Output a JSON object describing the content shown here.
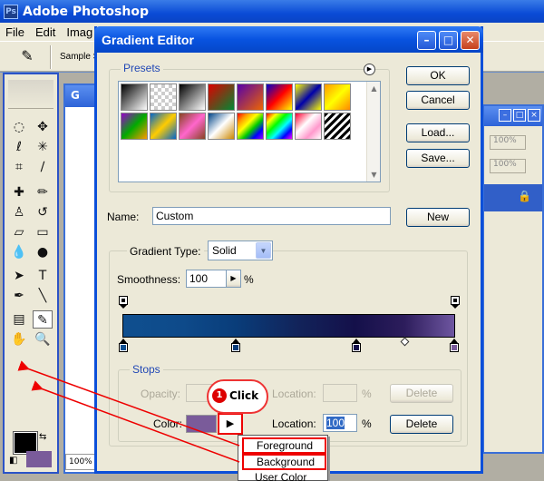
{
  "app": {
    "title": "Adobe Photoshop"
  },
  "menubar": [
    "File",
    "Edit",
    "Imag"
  ],
  "options_bar": {
    "sample_label": "Sample S"
  },
  "doc_window": {
    "title": "G",
    "zoom": "100%"
  },
  "right_panel": {
    "zoom_1": "100%",
    "zoom_2": "100%"
  },
  "dialog": {
    "title": "Gradient Editor",
    "presets_label": "Presets",
    "name_label": "Name:",
    "name_value": "Custom",
    "gradient_type_label": "Gradient Type:",
    "gradient_type_value": "Solid",
    "smoothness_label": "Smoothness:",
    "smoothness_value": "100",
    "smoothness_unit": "%",
    "stops_label": "Stops",
    "opacity_label": "Opacity:",
    "opacity_location_label": "Location:",
    "opacity_location_unit": "%",
    "color_label": "Color:",
    "color_location_label": "Location:",
    "color_location_value": "100",
    "color_location_unit": "%",
    "buttons": {
      "ok": "OK",
      "cancel": "Cancel",
      "load": "Load...",
      "save": "Save...",
      "new": "New",
      "delete_opacity": "Delete",
      "delete_color": "Delete"
    },
    "stop_color": "#7a5b9a"
  },
  "callout": {
    "number": "1",
    "text": "Click"
  },
  "popup_menu": {
    "items": [
      "Foreground",
      "Background",
      "User Color"
    ]
  }
}
